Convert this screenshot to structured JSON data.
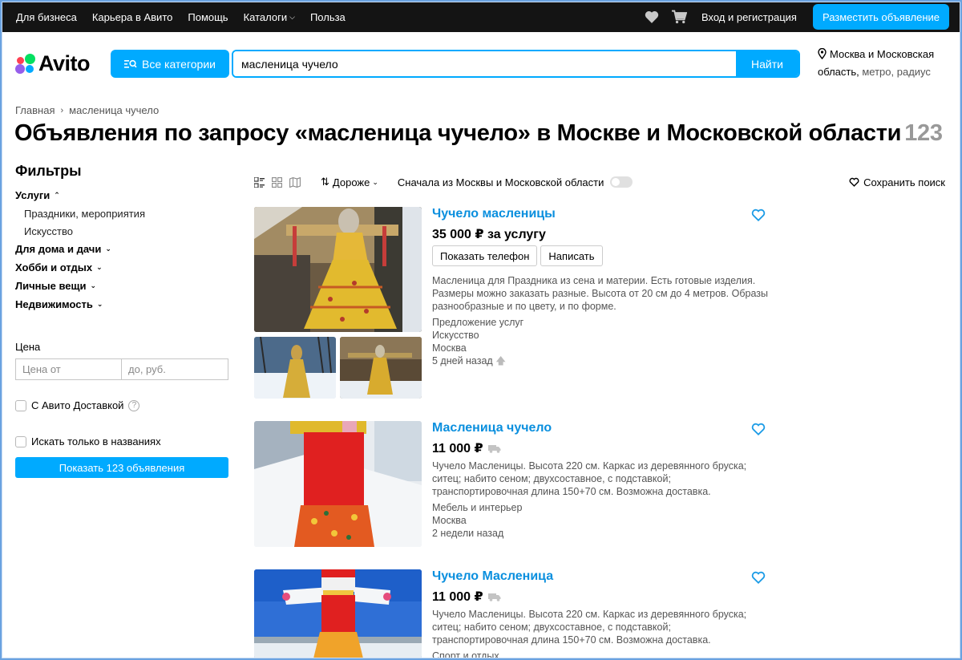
{
  "topbar": {
    "links": [
      "Для бизнеса",
      "Карьера в Авито",
      "Помощь",
      "Каталоги",
      "Польза"
    ],
    "login": "Вход и регистрация",
    "post_ad": "Разместить объявление"
  },
  "header": {
    "logo": "Avito",
    "categories_button": "Все категории",
    "search_value": "масленица чучело",
    "search_button": "Найти",
    "location_line1": "Москва и Московская",
    "location_line2": "область,",
    "location_extra": " метро, радиус"
  },
  "breadcrumbs": [
    "Главная",
    "масленица чучело"
  ],
  "title": "Объявления по запросу «масленица чучело» в Москве и Московской области",
  "result_count": "123",
  "filters": {
    "heading": "Фильтры",
    "services": "Услуги",
    "services_sub": [
      "Праздники, мероприятия",
      "Искусство"
    ],
    "categories": [
      "Для дома и дачи",
      "Хобби и отдых",
      "Личные вещи",
      "Недвижимость"
    ],
    "price_label": "Цена",
    "price_from_placeholder": "Цена от",
    "price_to_placeholder": "до, руб.",
    "delivery_label": "С Авито Доставкой",
    "titles_only_label": "Искать только в названиях",
    "show_button": "Показать 123 объявления"
  },
  "toolbar": {
    "sort": "Дороже",
    "moscow_first": "Сначала из Москвы и Московской области",
    "save_search": "Сохранить поиск"
  },
  "listings": [
    {
      "title": "Чучело масленицы",
      "price": "35 000 ₽ за услугу",
      "phone_button": "Показать телефон",
      "write_button": "Написать",
      "desc": "Масленица для Праздника из сена и материи. Есть готовые изделия. Размеры можно заказать разные. Высота от 20 см до 4 метров. Образы разнообразные и по цвету, и по форме.",
      "meta": [
        "Предложение услуг",
        "Искусство",
        "Москва",
        "5 дней назад"
      ]
    },
    {
      "title": "Масленица чучело",
      "price": "11 000 ₽",
      "desc": "Чучело Масленицы. Высота 220 см. Каркас из деревянного бруска; ситец; набито сеном; двухсоставное, с подставкой; транспортировочная длина 150+70 см. Возможна доставка.",
      "meta": [
        "Мебель и интерьер",
        "Москва",
        "2 недели назад"
      ]
    },
    {
      "title": "Чучело Масленица",
      "price": "11 000 ₽",
      "desc": "Чучело Масленицы. Высота 220 см. Каркас из деревянного бруска; ситец; набито сеном; двухсоставное, с подставкой; транспортировочная длина 150+70 см. Возможна доставка.",
      "meta": [
        "Спорт и отдых"
      ]
    }
  ],
  "colors": {
    "accent": "#00aaff",
    "link": "#0a8fde",
    "topbar": "#141414"
  }
}
